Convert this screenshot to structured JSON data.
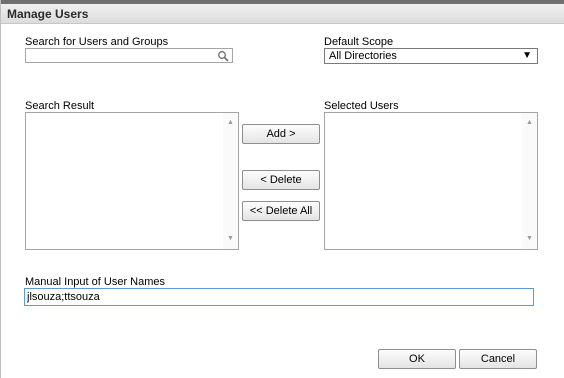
{
  "dialog": {
    "title": "Manage Users"
  },
  "search": {
    "label": "Search for Users and Groups",
    "value": "",
    "placeholder": ""
  },
  "scope": {
    "label": "Default Scope",
    "selected": "All Directories"
  },
  "search_result": {
    "label": "Search Result",
    "items": []
  },
  "selected_users": {
    "label": "Selected Users",
    "items": []
  },
  "buttons": {
    "add": "Add >",
    "delete": "< Delete",
    "delete_all": "<< Delete All",
    "ok": "OK",
    "cancel": "Cancel"
  },
  "manual_input": {
    "label": "Manual Input of User Names",
    "value": "jlsouza;ttsouza"
  },
  "colors": {
    "input_focus_border": "#5b9bd5",
    "title_bar": "#dcdcdc"
  }
}
